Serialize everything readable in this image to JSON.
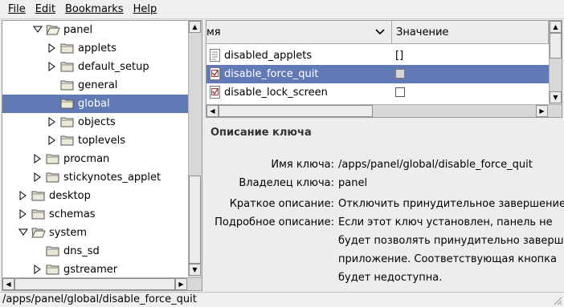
{
  "menubar": {
    "file": "File",
    "edit": "Edit",
    "bookmarks": "Bookmarks",
    "help": "Help"
  },
  "tree": {
    "items": [
      {
        "label": "panel",
        "level": 2,
        "expanded": true,
        "has_children": true
      },
      {
        "label": "applets",
        "level": 3,
        "expanded": false,
        "has_children": true
      },
      {
        "label": "default_setup",
        "level": 3,
        "expanded": false,
        "has_children": true
      },
      {
        "label": "general",
        "level": 3,
        "expanded": false,
        "has_children": false
      },
      {
        "label": "global",
        "level": 3,
        "expanded": false,
        "has_children": false,
        "selected": true
      },
      {
        "label": "objects",
        "level": 3,
        "expanded": false,
        "has_children": true
      },
      {
        "label": "toplevels",
        "level": 3,
        "expanded": false,
        "has_children": true
      },
      {
        "label": "procman",
        "level": 2,
        "expanded": false,
        "has_children": true
      },
      {
        "label": "stickynotes_applet",
        "level": 2,
        "expanded": false,
        "has_children": true
      },
      {
        "label": "desktop",
        "level": 1,
        "expanded": false,
        "has_children": true
      },
      {
        "label": "schemas",
        "level": 1,
        "expanded": false,
        "has_children": true
      },
      {
        "label": "system",
        "level": 1,
        "expanded": true,
        "has_children": true
      },
      {
        "label": "dns_sd",
        "level": 2,
        "expanded": false,
        "has_children": false
      },
      {
        "label": "gstreamer",
        "level": 2,
        "expanded": false,
        "has_children": true
      }
    ]
  },
  "list": {
    "col_name": "мя",
    "col_value": "Значение",
    "rows": [
      {
        "name": "disabled_applets",
        "value": "[]",
        "type": "list"
      },
      {
        "name": "disable_force_quit",
        "value": "",
        "type": "bool",
        "selected": true
      },
      {
        "name": "disable_lock_screen",
        "value": "",
        "type": "bool"
      }
    ]
  },
  "description": {
    "title": "Описание ключа",
    "key_name_label": "Имя ключа:",
    "key_name_value": "/apps/panel/global/disable_force_quit",
    "owner_label": "Владелец ключа:",
    "owner_value": "panel",
    "short_label": "Краткое описание:",
    "short_value": "Отключить принудительное завершение",
    "long_label": "Подробное описание:",
    "long_value_lines": [
      "Если этот ключ установлен, панель не",
      "будет позволять принудительно завершать",
      "приложение. Соответствующая кнопка",
      "будет недоступна."
    ]
  },
  "statusbar": {
    "path": "/apps/panel/global/disable_force_quit"
  }
}
